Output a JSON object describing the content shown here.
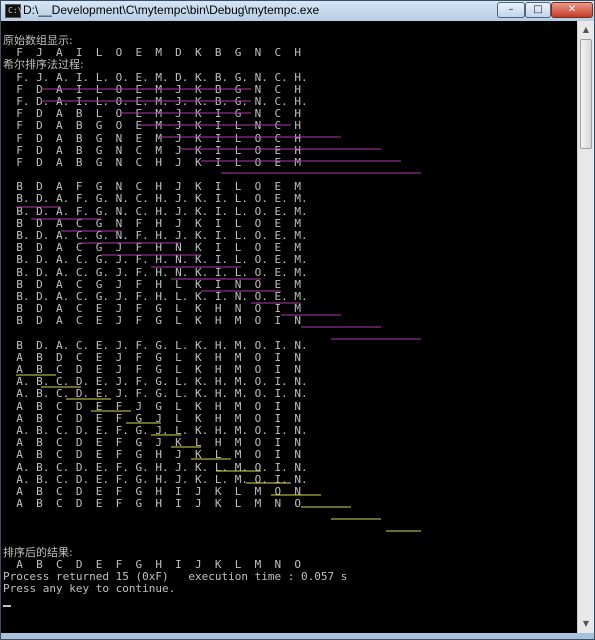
{
  "window": {
    "title": "D:\\__Development\\C\\mytempc\\bin\\Debug\\mytempc.exe",
    "icon": "console-app-icon",
    "controls": {
      "minimize": "–",
      "maximize": "□",
      "close": "✕"
    }
  },
  "console": {
    "lines": [
      "原始数组显示:",
      "  F  J  A  I  L  O  E  M  D  K  B  G  N  C  H",
      "希尔排序法过程:",
      "  F. J. A. I. L. O. E. M. D. K. B. G. N. C. H.",
      "  F  D  A  I  L  O  E  M  J  K  B  G  N  C  H",
      "  F. D. A. I. L. O. E. M. J. K. B. G. N. C. H.",
      "  F  D  A  B  L  O  E  M  J  K  I  G  N  C  H",
      "  F  D  A  B  G  O  E  M  J  K  I  L  N  C  H",
      "  F  D  A  B  G  N  E  M  J  K  I  L  O  C  H",
      "  F  D  A  B  G  N  C  M  J  K  I  L  O  E  H",
      "  F  D  A  B  G  N  C  H  J  K  I  L  O  E  M",
      "",
      "  B  D  A  F  G  N  C  H  J  K  I  L  O  E  M",
      "  B. D. A. F. G. N. C. H. J. K. I. L. O. E. M.",
      "  B. D. A. F. G. N. C. H. J. K. I. L. O. E. M.",
      "  B  D  A  C  G  N  F  H  J  K  I  L  O  E  M",
      "  B. D. A. C. G. N. F. H. J. K. I. L. O. E. M.",
      "  B  D  A  C  G  J  F  H  N  K  I  L  O  E  M",
      "  B. D. A. C. G. J. F. H. N. K. I. L. O. E. M.",
      "  B. D. A. C. G. J. F. H. N. K. I. L. O. E. M.",
      "  B  D  A  C  G  J  F  H  L  K  I  N  O  E  M",
      "  B. D. A. C. G. J. F. H. L. K. I. N. O. E. M.",
      "  B  D  A  C  E  J  F  G  L  K  H  N  O  I  M",
      "  B  D  A  C  E  J  F  G  L  K  H  M  O  I  N",
      "",
      "  B  D. A. C. E. J. F. G. L. K. H. M. O. I. N.",
      "  A  B  D  C  E  J  F  G  L  K  H  M  O  I  N",
      "  A  B  C  D  E  J  F  G  L  K  H  M  O  I  N",
      "  A. B. C. D. E. J. F. G. L. K. H. M. O. I. N.",
      "  A. B. C. D. E. J. F. G. L. K. H. M. O. I. N.",
      "  A  B  C  D  E  F  J  G  L  K  H  M  O  I  N",
      "  A  B  C  D  E  F  G  J  L  K  H  M  O  I  N",
      "  A. B. C. D. E. F. G. J. L. K. H. M. O. I. N.",
      "  A  B  C  D  E  F  G  J  K  L  H  M  O  I  N",
      "  A  B  C  D  E  F  G  H  J  K  L  M  O  I  N",
      "  A. B. C. D. E. F. G. H. J. K. L. M. O. I. N.",
      "  A. B. C. D. E. F. G. H. J. K. L. M. O. I. N.",
      "  A  B  C  D  E  F  G  H  I  J  K  L  M  O  N",
      "  A  B  C  D  E  F  G  H  I  J  K  L  M  N  O",
      "",
      "",
      "",
      "排序后的结果:",
      "  A  B  C  D  E  F  G  H  I  J  K  L  M  N  O",
      "Process returned 15 (0xF)   execution time : 0.057 s",
      "Press any key to continue."
    ],
    "underline_colors": {
      "pass1": "#b03aa8",
      "pass2": "#b03aa8",
      "pass3": "#d8d84a"
    }
  },
  "scrollbar": {
    "up_arrow": "▲",
    "down_arrow": "▼"
  }
}
